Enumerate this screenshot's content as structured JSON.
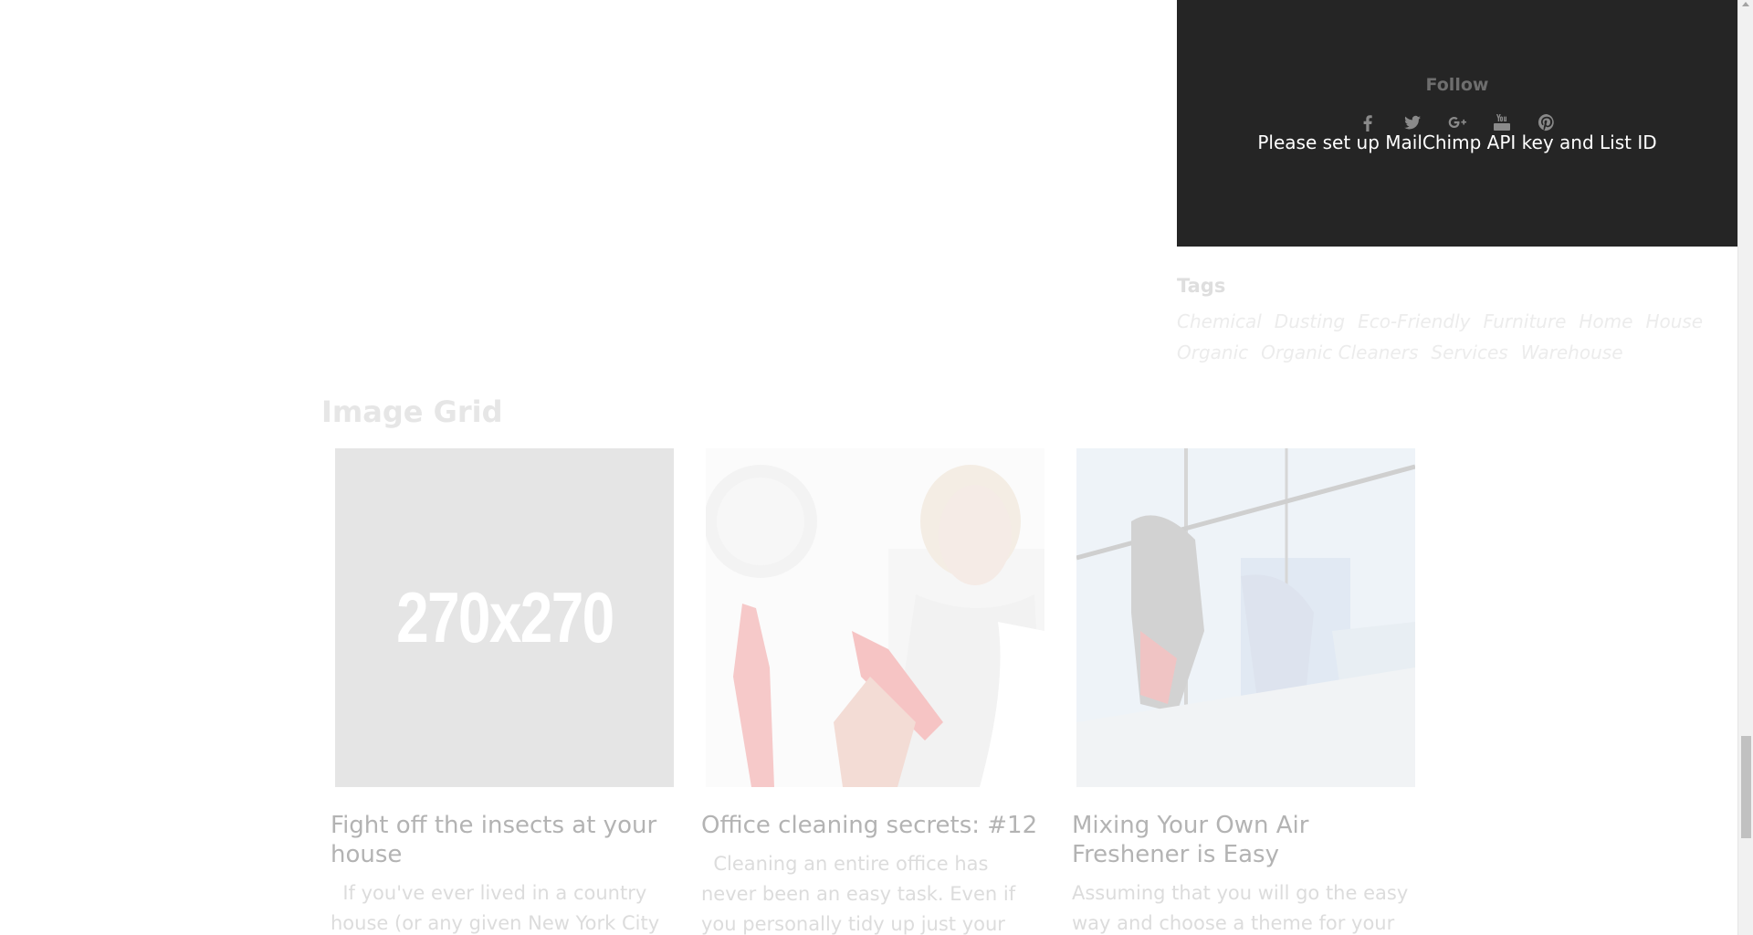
{
  "follow_widget": {
    "title": "Follow",
    "social_icons": [
      "facebook-icon",
      "twitter-icon",
      "google-plus-icon",
      "youtube-icon",
      "pinterest-icon"
    ],
    "mailchimp_message": "Please set up MailChimp API key and List ID",
    "background_color": "#252525"
  },
  "tags_widget": {
    "title": "Tags",
    "tags": [
      "Chemical",
      "Dusting",
      "Eco-Friendly",
      "Furniture",
      "Home",
      "House",
      "Organic",
      "Organic Cleaners",
      "Services",
      "Warehouse"
    ]
  },
  "image_grid": {
    "title": "Image Grid",
    "cards": [
      {
        "image_label": "270x270",
        "title": "Fight off the insects at your house",
        "excerpt": "  If you've ever lived in a country house (or any given New York City"
      },
      {
        "image_label": "",
        "title": "Office cleaning secrets: #12",
        "excerpt": "  Cleaning an entire office has never been an easy task. Even if you personally tidy up just your personal"
      },
      {
        "image_label": "",
        "title": "Mixing Your Own Air Freshener is Easy",
        "excerpt": "Assuming that you will go the easy way and choose a theme for your"
      }
    ]
  }
}
